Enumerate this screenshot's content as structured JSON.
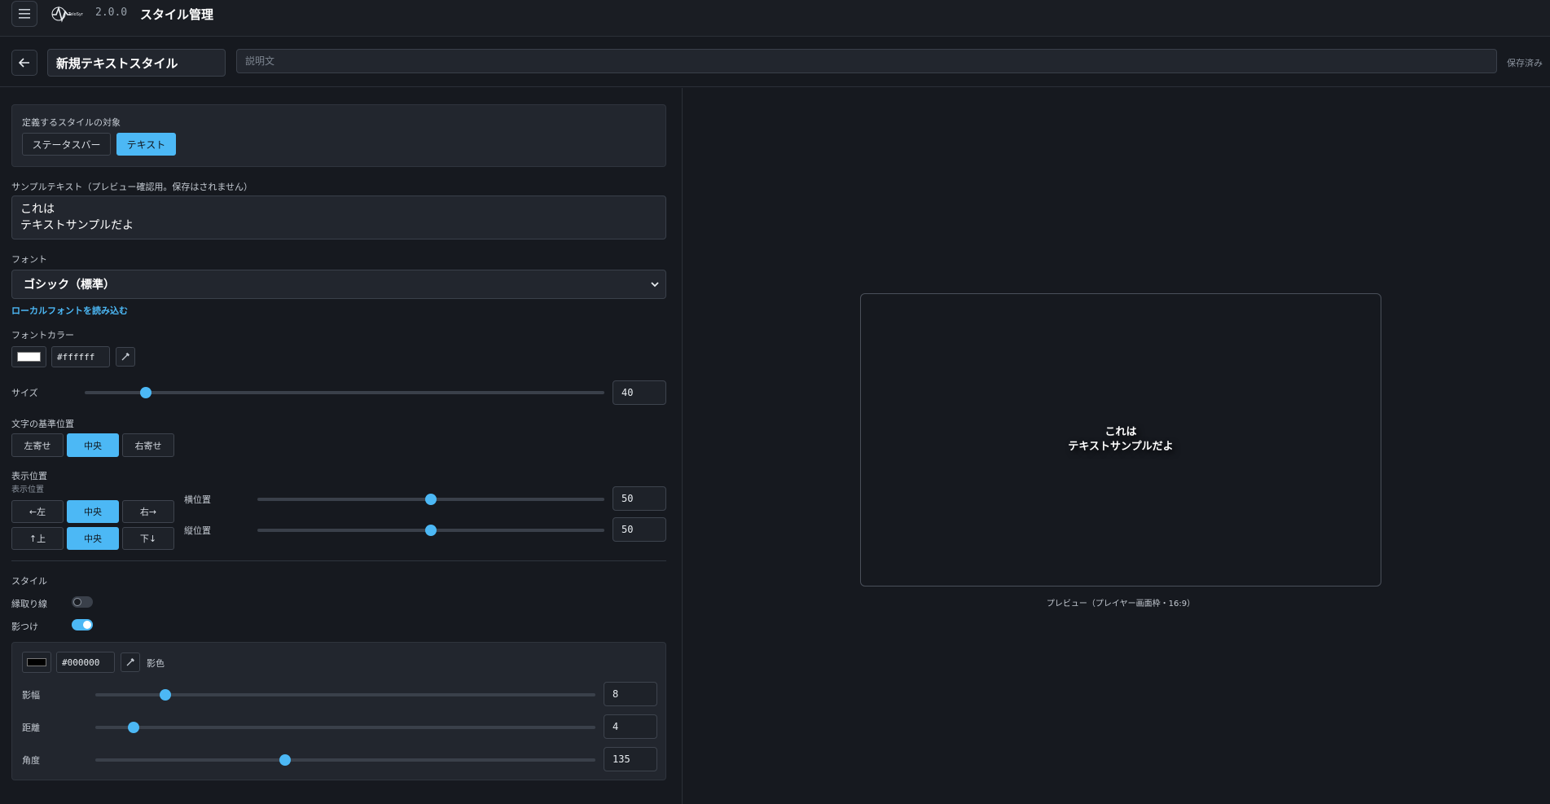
{
  "app": {
    "version": "2.0.0",
    "title": "スタイル管理",
    "logo_text": "TeloSync"
  },
  "header": {
    "style_name": "新規テキストスタイル",
    "description_placeholder": "説明文",
    "save_status": "保存済み"
  },
  "target": {
    "label": "定義するスタイルの対象",
    "options": [
      "ステータスバー",
      "テキスト"
    ],
    "selected": "テキスト"
  },
  "sample": {
    "label": "サンプルテキスト（プレビュー確認用。保存はされません）",
    "value": "これは\nテキストサンプルだよ"
  },
  "font": {
    "label": "フォント",
    "selected": "ゴシック（標準）",
    "load_local_link": "ローカルフォントを読み込む"
  },
  "font_color": {
    "label": "フォントカラー",
    "hex": "#ffffff",
    "swatch": "#ffffff"
  },
  "size": {
    "label": "サイズ",
    "value": "40",
    "fraction": 0.117
  },
  "alignment": {
    "label": "文字の基準位置",
    "options": [
      "左寄せ",
      "中央",
      "右寄せ"
    ],
    "selected": "中央"
  },
  "position": {
    "label": "表示位置",
    "sublabel": "表示位置",
    "horizontal_buttons": [
      "←左",
      "中央",
      "右→"
    ],
    "vertical_buttons": [
      "↑上",
      "中央",
      "下↓"
    ],
    "horizontal": {
      "label": "横位置",
      "value": "50",
      "fraction": 0.5
    },
    "vertical": {
      "label": "縦位置",
      "value": "50",
      "fraction": 0.5
    }
  },
  "style": {
    "label": "スタイル",
    "outline": {
      "label": "縁取り線",
      "on": false
    },
    "shadow": {
      "label": "影つけ",
      "on": true,
      "color_hex": "#000000",
      "color_swatch": "#000000",
      "color_label": "影色",
      "width": {
        "label": "影幅",
        "value": "8",
        "fraction": 0.14
      },
      "distance": {
        "label": "距離",
        "value": "4",
        "fraction": 0.076
      },
      "angle": {
        "label": "角度",
        "value": "135",
        "fraction": 0.38
      }
    }
  },
  "preview": {
    "text": "これは\nテキストサンプルだよ",
    "caption": "プレビュー（プレイヤー画面枠・16:9）"
  },
  "colors": {
    "accent": "#4cb8f5",
    "background": "#16191f",
    "panel": "#22262e"
  }
}
